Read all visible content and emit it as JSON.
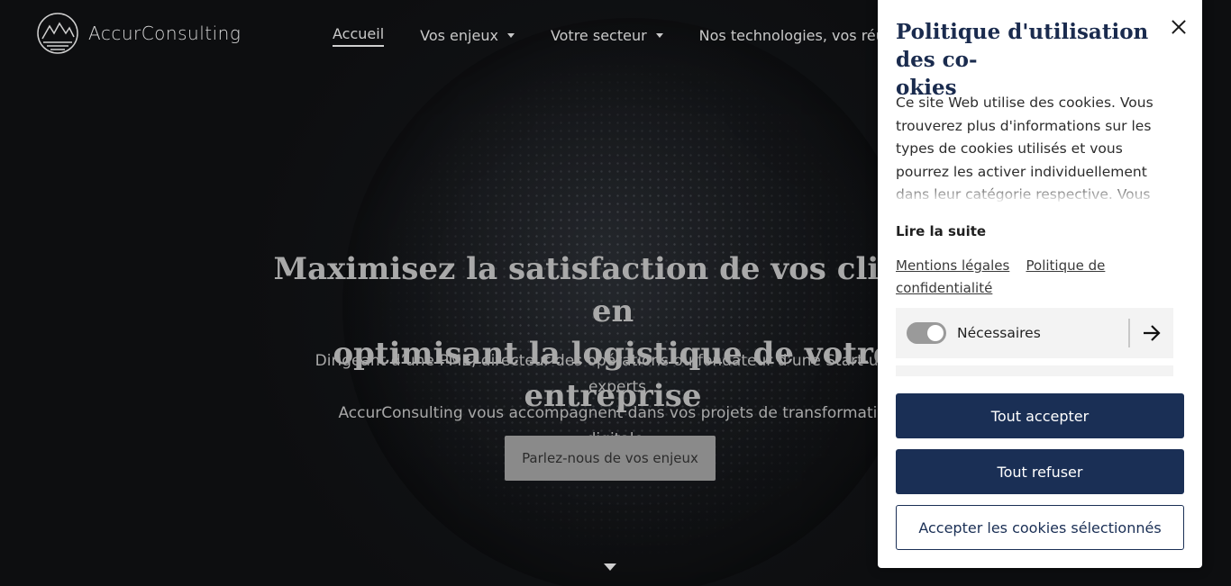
{
  "brand": {
    "name": "AccurConsulting"
  },
  "nav": {
    "items": [
      {
        "label": "Accueil"
      },
      {
        "label": "Vos enjeux"
      },
      {
        "label": "Votre secteur"
      },
      {
        "label": "Nos technologies, vos réussites"
      }
    ]
  },
  "hero": {
    "title": "Maximisez la satisfaction de vos clients en\noptimisant la logistique de votre entreprise",
    "subtitle": "Dirigeant d’une PME, directeur des opérations ou fondateur d’une Start-up, les experts\nAccurConsulting vous accompagnent dans vos projets de transformation digitale.",
    "cta": "Parlez-nous de vos enjeux"
  },
  "cookie": {
    "title": "Politique d'utilisation des co-\nokies",
    "body": "Ce site Web utilise des cookies. Vous trouverez plus d'informations sur les types de cookies utilisés et vous pourrez les activer individuellement dans leur catégorie respective. Vous pouvez ajuster vos",
    "read_more": "Lire la suite",
    "links": {
      "legal": "Mentions légales",
      "privacy": "Politique de confidentialité"
    },
    "categories": [
      {
        "label": "Nécessaires",
        "enabled": true
      }
    ],
    "buttons": {
      "accept_all": "Tout accepter",
      "refuse_all": "Tout refuser",
      "accept_selected": "Accepter les cookies sélectionnés"
    }
  },
  "colors": {
    "primary": "#1a2f55",
    "cta_bg": "#8a8a8a",
    "background": "#0d0e10"
  }
}
